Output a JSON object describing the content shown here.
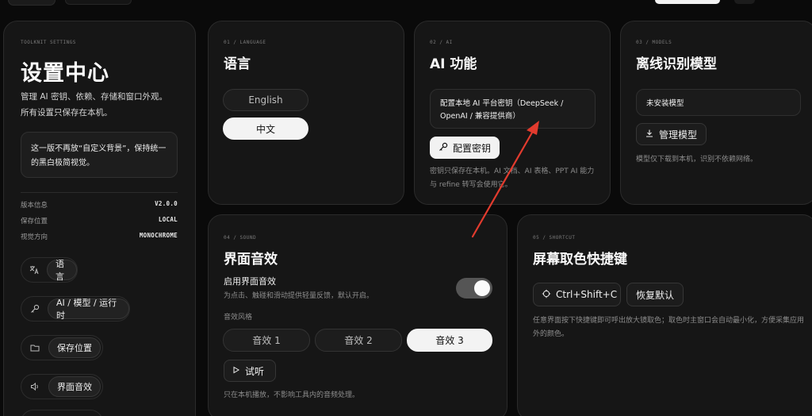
{
  "sidebar": {
    "eyebrow": "TOOLKNIT SETTINGS",
    "title": "设置中心",
    "desc_line1": "管理 AI 密钥、依赖、存储和窗口外观。",
    "desc_line2": "所有设置只保存在本机。",
    "note": "这一版不再放“自定义背景”，保持统一的黑白极简视觉。",
    "meta": [
      {
        "label": "版本信息",
        "value": "V2.0.0"
      },
      {
        "label": "保存位置",
        "value": "LOCAL"
      },
      {
        "label": "视觉方向",
        "value": "MONOCHROME"
      }
    ],
    "nav": [
      {
        "icon": "translate-icon",
        "label": "语言"
      },
      {
        "icon": "key-icon",
        "label": "AI / 模型 / 运行时"
      },
      {
        "icon": "folder-icon",
        "label": "保存位置"
      },
      {
        "icon": "speaker-icon",
        "label": "界面音效"
      }
    ]
  },
  "language": {
    "eyebrow": "01 / LANGUAGE",
    "title": "语言",
    "options": [
      "English",
      "中文"
    ],
    "selected": "中文"
  },
  "ai": {
    "eyebrow": "02 / AI",
    "title": "AI 功能",
    "box_text": "配置本地 AI 平台密钥（DeepSeek / OpenAI / 兼容提供商）",
    "button": "配置密钥",
    "note": "密钥只保存在本机。AI 文档、AI 表格、PPT AI 能力与 refine 转写会使用它。"
  },
  "models": {
    "eyebrow": "03 / MODELS",
    "title": "离线识别模型",
    "status": "未安装模型",
    "button": "管理模型",
    "note": "模型仅下载到本机，识别不依赖网络。"
  },
  "sound": {
    "eyebrow": "04 / SOUND",
    "title": "界面音效",
    "toggle_label": "启用界面音效",
    "toggle_desc": "为点击、触碰和滑动提供轻量反馈，默认开启。",
    "toggle_on": true,
    "style_label": "音效风格",
    "styles": [
      "音效 1",
      "音效 2",
      "音效 3"
    ],
    "selected_style": "音效 3",
    "preview": "试听",
    "note": "只在本机播放，不影响工具内的音频处理。"
  },
  "shortcut": {
    "eyebrow": "05 / SHORTCUT",
    "title": "屏幕取色快捷键",
    "key": "Ctrl+Shift+C",
    "reset": "恢复默认",
    "note": "任意界面按下快捷键即可呼出放大镜取色；取色时主窗口会自动最小化，方便采集应用外的颜色。"
  },
  "colors": {
    "arrow": "#e23b2e",
    "accent": "#f3f3f3",
    "bg": "#0a0a0a"
  }
}
